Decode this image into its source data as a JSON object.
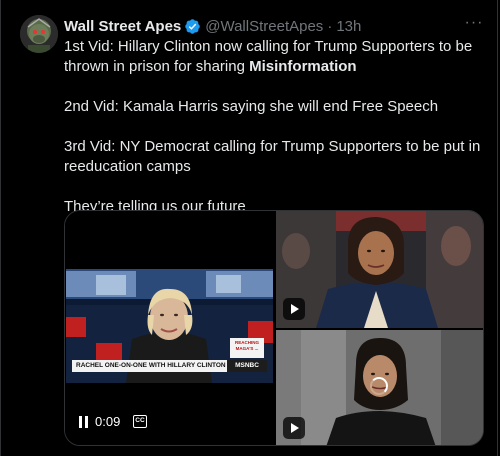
{
  "tweet": {
    "author_name": "Wall Street Apes",
    "handle": "@WallStreetApes",
    "separator": "·",
    "time": "13h",
    "more_glyph": "···",
    "lines": {
      "p1_main": "1st Vid: Hillary Clinton now calling for Trump Supporters to be thrown in prison for sharing ",
      "p1_bold": "Misinformation",
      "p2": "2nd Vid: Kamala Harris saying she will end Free Speech",
      "p3": "3rd Vid: NY Democrat calling for Trump Supporters to be put in reeducation camps",
      "p4": "They’re telling us our future"
    },
    "colors": {
      "background": "#000000",
      "text": "#e7e9ea",
      "secondary": "#71767b",
      "verified": "#1d9bf0"
    }
  },
  "media": {
    "video1": {
      "chyron": "RACHEL ONE-ON-ONE WITH HILLARY CLINTON",
      "network": "MSNBC",
      "sidebar_text": "REACHING MAGA'S ...",
      "timecode": "0:09",
      "cc_label": "CC",
      "state": "playing"
    },
    "video2": {
      "state": "paused",
      "play_icon": "play-icon"
    },
    "video3": {
      "state": "loading",
      "play_icon": "play-icon"
    }
  }
}
